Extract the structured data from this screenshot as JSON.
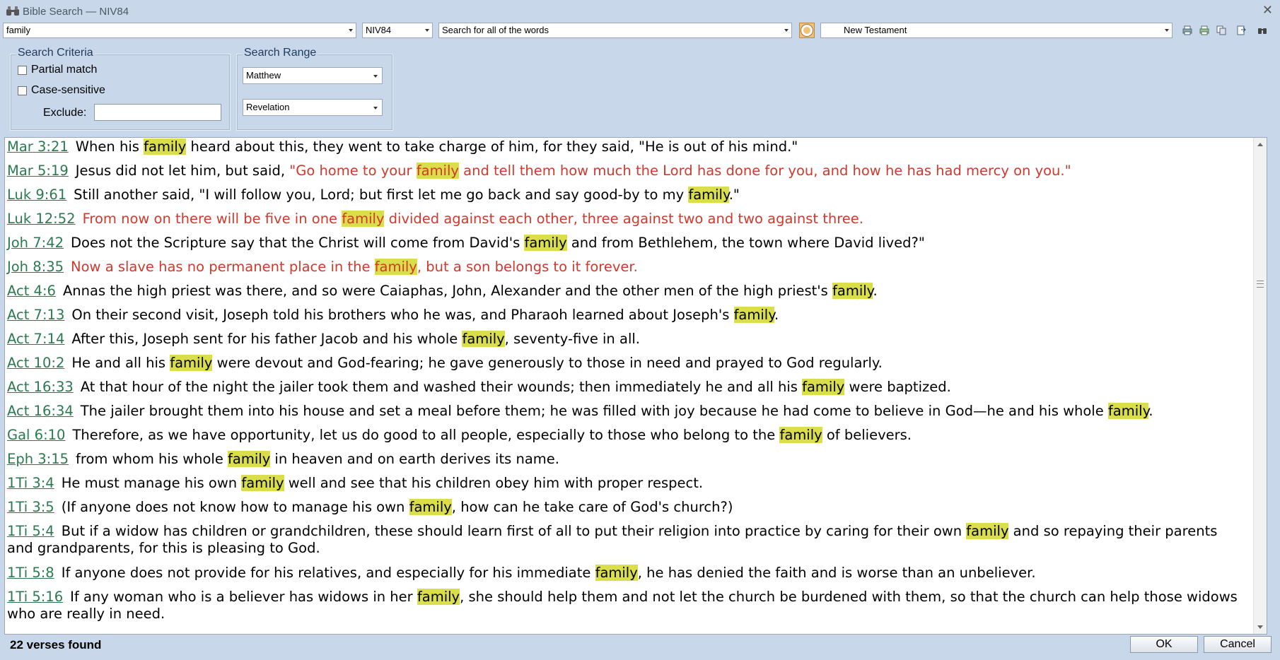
{
  "window": {
    "title": "Bible Search — NIV84"
  },
  "toolbar": {
    "search_value": "family",
    "version": "NIV84",
    "search_mode": "Search for all of the words",
    "range_preset": "New Testament"
  },
  "criteria": {
    "legend": "Search Criteria",
    "partial_match_label": "Partial match",
    "case_sensitive_label": "Case-sensitive",
    "exclude_label": "Exclude:",
    "partial_match_checked": false,
    "case_sensitive_checked": false
  },
  "range": {
    "legend": "Search Range",
    "from": "Matthew",
    "to": "Revelation"
  },
  "results": [
    {
      "ref": "Mar 3:21",
      "parts": [
        {
          "t": "When his "
        },
        {
          "t": "family",
          "hl": true
        },
        {
          "t": " heard about this, they went to take charge of him, for they said, \"He is out of his mind.\""
        }
      ]
    },
    {
      "ref": "Mar 5:19",
      "parts": [
        {
          "t": "Jesus did not let him, but said, "
        },
        {
          "t": "\"Go home to your ",
          "red": true
        },
        {
          "t": "family",
          "hl": true,
          "red": true
        },
        {
          "t": " and tell them how much the Lord has done for you, and how he has had mercy on you.\"",
          "red": true
        }
      ]
    },
    {
      "ref": "Luk 9:61",
      "parts": [
        {
          "t": "Still another said, \"I will follow you, Lord; but first let me go back and say good-by to my "
        },
        {
          "t": "family",
          "hl": true
        },
        {
          "t": ".\""
        }
      ]
    },
    {
      "ref": "Luk 12:52",
      "parts": [
        {
          "t": "From now on there will be five in one ",
          "red": true
        },
        {
          "t": "family",
          "hl": true,
          "red": true
        },
        {
          "t": " divided against each other, three against two and two against three.",
          "red": true
        }
      ]
    },
    {
      "ref": "Joh 7:42",
      "parts": [
        {
          "t": "Does not the Scripture say that the Christ will come from David's "
        },
        {
          "t": "family",
          "hl": true
        },
        {
          "t": " and from Bethlehem, the town where David lived?\""
        }
      ]
    },
    {
      "ref": "Joh 8:35",
      "parts": [
        {
          "t": "Now a slave has no permanent place in the ",
          "red": true
        },
        {
          "t": "family",
          "hl": true,
          "red": true
        },
        {
          "t": ", but a son belongs to it forever.",
          "red": true
        }
      ]
    },
    {
      "ref": "Act 4:6",
      "parts": [
        {
          "t": "Annas the high priest was there, and so were Caiaphas, John, Alexander and the other men of the high priest's "
        },
        {
          "t": "family",
          "hl": true
        },
        {
          "t": "."
        }
      ]
    },
    {
      "ref": "Act 7:13",
      "parts": [
        {
          "t": "On their second visit, Joseph told his brothers who he was, and Pharaoh learned about Joseph's "
        },
        {
          "t": "family",
          "hl": true
        },
        {
          "t": "."
        }
      ]
    },
    {
      "ref": "Act 7:14",
      "parts": [
        {
          "t": "After this, Joseph sent for his father Jacob and his whole "
        },
        {
          "t": "family",
          "hl": true
        },
        {
          "t": ", seventy-five in all."
        }
      ]
    },
    {
      "ref": "Act 10:2",
      "parts": [
        {
          "t": "He and all his "
        },
        {
          "t": "family",
          "hl": true
        },
        {
          "t": " were devout and God-fearing; he gave generously to those in need and prayed to God regularly."
        }
      ]
    },
    {
      "ref": "Act 16:33",
      "parts": [
        {
          "t": "At that hour of the night the jailer took them and washed their wounds; then immediately he and all his "
        },
        {
          "t": "family",
          "hl": true
        },
        {
          "t": " were baptized."
        }
      ]
    },
    {
      "ref": "Act 16:34",
      "parts": [
        {
          "t": "The jailer brought them into his house and set a meal before them; he was filled with joy because he had come to believe in God—he and his whole "
        },
        {
          "t": "family",
          "hl": true
        },
        {
          "t": "."
        }
      ]
    },
    {
      "ref": "Gal 6:10",
      "parts": [
        {
          "t": "Therefore, as we have opportunity, let us do good to all people, especially to those who belong to the "
        },
        {
          "t": "family",
          "hl": true
        },
        {
          "t": " of believers."
        }
      ]
    },
    {
      "ref": "Eph 3:15",
      "parts": [
        {
          "t": "from whom his whole "
        },
        {
          "t": "family",
          "hl": true
        },
        {
          "t": " in heaven and on earth derives its name."
        }
      ]
    },
    {
      "ref": "1Ti 3:4",
      "parts": [
        {
          "t": "He must manage his own "
        },
        {
          "t": "family",
          "hl": true
        },
        {
          "t": " well and see that his children obey him with proper respect."
        }
      ]
    },
    {
      "ref": "1Ti 3:5",
      "parts": [
        {
          "t": "(If anyone does not know how to manage his own "
        },
        {
          "t": "family",
          "hl": true
        },
        {
          "t": ", how can he take care of God's church?)"
        }
      ]
    },
    {
      "ref": "1Ti 5:4",
      "parts": [
        {
          "t": "But if a widow has children or grandchildren, these should learn first of all to put their religion into practice by caring for their own "
        },
        {
          "t": "family",
          "hl": true
        },
        {
          "t": " and so repaying their parents and grandparents, for this is pleasing to God."
        }
      ]
    },
    {
      "ref": "1Ti 5:8",
      "parts": [
        {
          "t": "If anyone does not provide for his relatives, and especially for his immediate "
        },
        {
          "t": "family",
          "hl": true
        },
        {
          "t": ", he has denied the faith and is worse than an unbeliever."
        }
      ]
    },
    {
      "ref": "1Ti 5:16",
      "parts": [
        {
          "t": "If any woman who is a believer has widows in her "
        },
        {
          "t": "family",
          "hl": true
        },
        {
          "t": ", she should help them and not let the church be burdened with them, so that the church can help those widows who are really in need."
        }
      ]
    }
  ],
  "status": {
    "count_text": "22 verses found"
  },
  "buttons": {
    "ok": "OK",
    "cancel": "Cancel"
  }
}
